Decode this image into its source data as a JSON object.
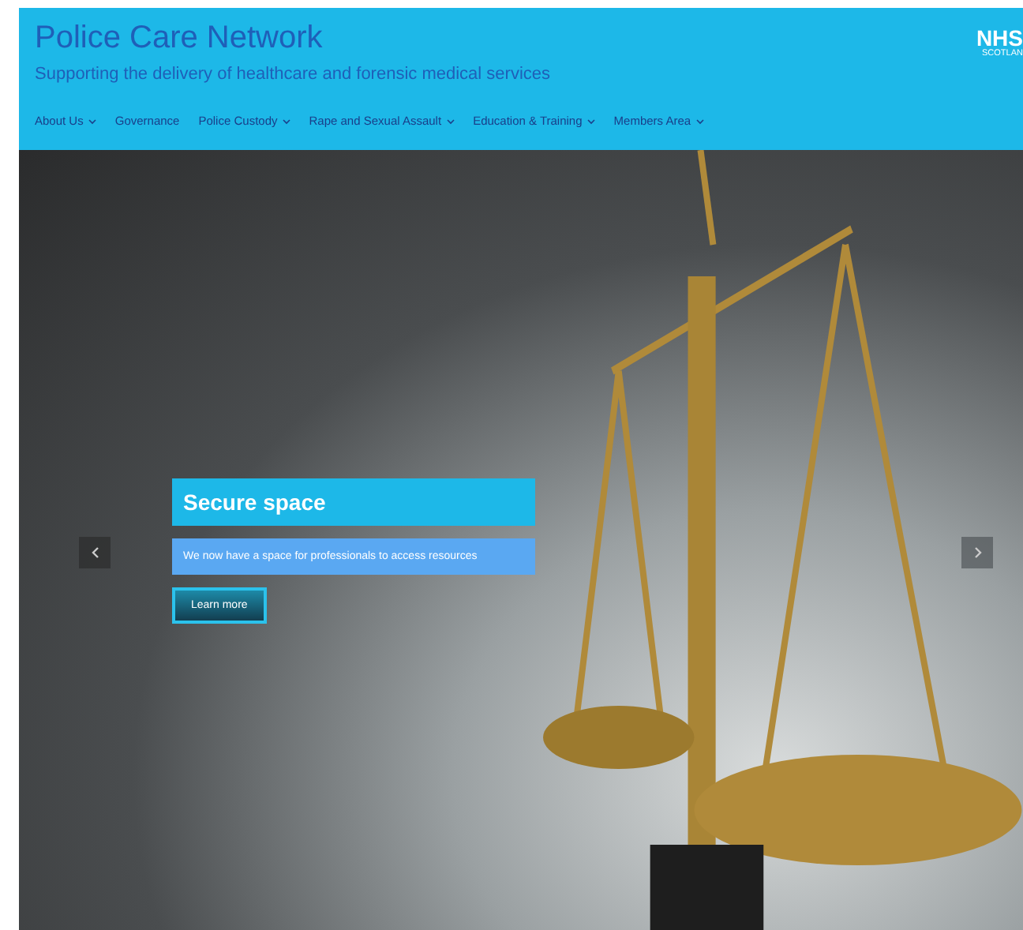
{
  "header": {
    "title": "Police Care Network",
    "tagline": "Supporting the delivery of healthcare and forensic medical services",
    "logo": {
      "mark": "NHS",
      "region": "SCOTLAN"
    }
  },
  "nav": [
    {
      "label": "About Us",
      "kind": "dropdown"
    },
    {
      "label": "Governance",
      "kind": "link"
    },
    {
      "label": "Police Custody",
      "kind": "dropdown"
    },
    {
      "label": "Rape and Sexual Assault",
      "kind": "dropdown"
    },
    {
      "label": "Education & Training",
      "kind": "dropdown"
    },
    {
      "label": "Members Area",
      "kind": "dropdown"
    }
  ],
  "slide": {
    "title": "Secure space",
    "text": "We now have a space for professionals to access resources",
    "button": "Learn more"
  }
}
